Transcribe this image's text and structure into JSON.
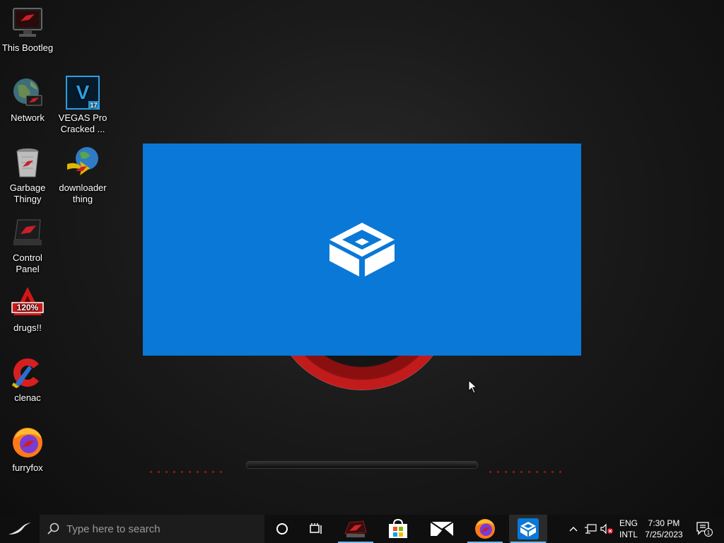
{
  "desktop_icons": [
    {
      "label": "This Bootleg",
      "icon": "computer-icon"
    },
    {
      "label": "Network",
      "icon": "network-globe-icon"
    },
    {
      "label": "VEGAS Pro Cracked ...",
      "icon": "vegas-pro-icon",
      "badge": "17"
    },
    {
      "label": "Garbage Thingy",
      "icon": "recycle-bin-icon"
    },
    {
      "label": "downloader thing",
      "icon": "download-manager-icon"
    },
    {
      "label": "Control Panel",
      "icon": "control-panel-icon"
    },
    {
      "label": "drugs!!",
      "icon": "alcohol-120-icon",
      "badge": "120%"
    },
    {
      "label": "clenac",
      "icon": "ccleaner-icon"
    },
    {
      "label": "furryfox",
      "icon": "firefox-icon"
    }
  ],
  "splash": {
    "app": "Windows Sandbox",
    "icon": "sandbox-box-icon",
    "color": "#0a78d7"
  },
  "taskbar": {
    "search_placeholder": "Type here to search",
    "apps": [
      {
        "name": "cortana",
        "icon": "cortana-circle-icon"
      },
      {
        "name": "task-view",
        "icon": "task-view-icon"
      },
      {
        "name": "rog-app",
        "icon": "rog-app-icon",
        "active": true
      },
      {
        "name": "microsoft-store",
        "icon": "store-bag-icon"
      },
      {
        "name": "mail",
        "icon": "mail-envelope-icon"
      },
      {
        "name": "firefox",
        "icon": "firefox-icon",
        "active": true
      },
      {
        "name": "sandbox",
        "icon": "sandbox-box-icon",
        "active": true
      }
    ],
    "tray": {
      "lang_top": "ENG",
      "lang_bottom": "INTL",
      "time": "7:30 PM",
      "date": "7/25/2023",
      "notification_count": "1"
    }
  }
}
